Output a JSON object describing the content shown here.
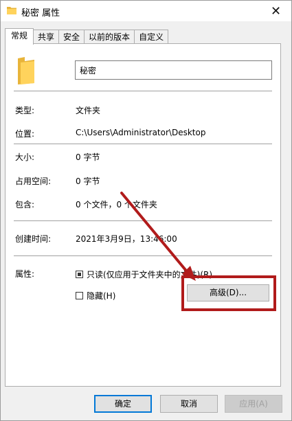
{
  "window": {
    "title": "秘密 属性"
  },
  "tabs": [
    {
      "label": "常规"
    },
    {
      "label": "共享"
    },
    {
      "label": "安全"
    },
    {
      "label": "以前的版本"
    },
    {
      "label": "自定义"
    }
  ],
  "general": {
    "folder_name": "秘密",
    "type_label": "类型:",
    "type_value": "文件夹",
    "location_label": "位置:",
    "location_value": "C:\\Users\\Administrator\\Desktop",
    "size_label": "大小:",
    "size_value": "0 字节",
    "disk_size_label": "占用空间:",
    "disk_size_value": "0 字节",
    "contains_label": "包含:",
    "contains_value": "0 个文件，0 个文件夹",
    "created_label": "创建时间:",
    "created_value": "2021年3月9日，13:46:00",
    "attributes_label": "属性:",
    "readonly_label": "只读(仅应用于文件夹中的文件)(R)",
    "hidden_label": "隐藏(H)",
    "advanced_label": "高级(D)..."
  },
  "footer": {
    "ok_label": "确定",
    "cancel_label": "取消",
    "apply_label": "应用(A)"
  },
  "colors": {
    "annotation": "#b11b1b",
    "folder": "#ffd35c",
    "accent": "#0078d7"
  },
  "icons": {
    "title": "folder-icon",
    "close": "close-icon",
    "big": "folder-icon"
  }
}
